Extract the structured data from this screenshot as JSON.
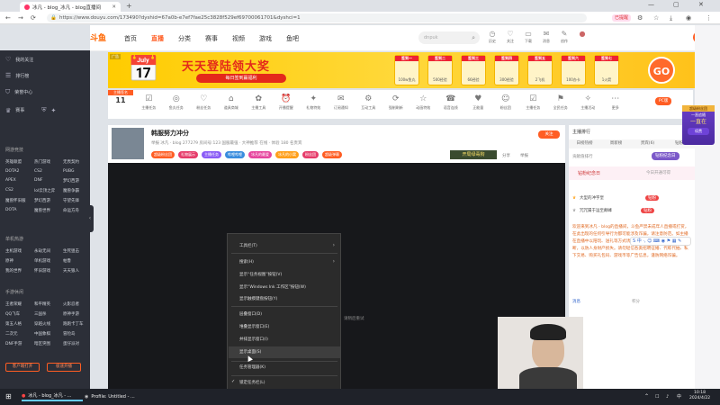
{
  "browser": {
    "tab_title": "冰凡 - blog_冰凡 - blog直播间",
    "url": "https://www.douyu.com/173490?dyshid=67a0b-e7ef7fae25c3828f529ef69700061701&dyshci=1",
    "ext_label": "已提醒",
    "ext2_label": "冰冰"
  },
  "header": {
    "logo": "斗鱼",
    "nav": [
      "首页",
      "直播",
      "分类",
      "赛事",
      "视频",
      "游戏",
      "鱼吧"
    ],
    "search_placeholder": "dnpuk",
    "icons": [
      {
        "icon": "history-icon",
        "label": "历史"
      },
      {
        "icon": "follow-icon",
        "label": "关注"
      },
      {
        "icon": "download-icon",
        "label": "下载"
      },
      {
        "icon": "message-icon",
        "label": "消息"
      },
      {
        "icon": "create-icon",
        "label": "创作"
      }
    ],
    "open_button": "开播"
  },
  "sidebar": {
    "items": [
      {
        "icon": "heart-icon",
        "label": "我的关注"
      },
      {
        "icon": "list-icon",
        "label": "排行榜"
      },
      {
        "icon": "shield-icon",
        "label": "荣誉中心"
      },
      {
        "icon": "trophy-icon",
        "label": "赛事"
      }
    ],
    "groups": [
      {
        "title": "网游竞技",
        "items": [
          "英雄联盟",
          "热门游戏",
          "无畏契约",
          "DOTA2",
          "CS2",
          "PUBG",
          "APEX",
          "DNF",
          "梦幻西游",
          "CS2",
          "lol云顶之弈",
          "魔兽争霸",
          "魔兽怀旧服",
          "梦幻西游",
          "守望先锋",
          "DOTA",
          "魔兽世界",
          "命运方舟"
        ]
      },
      {
        "title": "单机热游",
        "items": [
          "主机游戏",
          "永劫无间",
          "生死狙击",
          "原神",
          "单机游戏",
          "帕鲁",
          "我的世界",
          "怀旧游戏",
          "天天狼人"
        ]
      },
      {
        "title": "手游休闲",
        "items": [
          "王者荣耀",
          "和平精英",
          "火影忍者",
          "QQ飞车",
          "三国杀",
          "原神手游",
          "第五人格",
          "穿越火线",
          "跑跑卡丁车",
          "二次元",
          "中国象棋",
          "冒险岛",
          "DNF手游",
          "暗区突围",
          "蛋仔派对"
        ]
      }
    ],
    "btn_left": "客户端打开",
    "btn_right": "极速开播"
  },
  "banner": {
    "tag": "广告",
    "title": "天天登陆领大奖",
    "subtitle": "每日签到赢福利",
    "prizes": [
      {
        "day": "签到一",
        "label": "100w鱼丸"
      },
      {
        "day": "签到二",
        "label": "500经验"
      },
      {
        "day": "签到三",
        "label": "66经验"
      },
      {
        "day": "签到四",
        "label": "300经验"
      },
      {
        "day": "签到五",
        "label": "2飞机"
      },
      {
        "day": "签到六",
        "label": "100办卡"
      },
      {
        "day": "签到七",
        "label": "1火箭"
      }
    ],
    "go": "GO"
  },
  "iconrow": {
    "level_tag": "主播签名",
    "level": "11",
    "items": [
      "主播任务",
      "鱼丸任务",
      "粉丝任务",
      "道具商城",
      "主播工具",
      "开播提醒",
      "礼物特效",
      "订阅通知",
      "互动工具",
      "强制刷新",
      "动画特效",
      "语音连线",
      "正能量",
      "粉丝团",
      "主播任务",
      "全民任务",
      "主播活动",
      "更多"
    ],
    "pc_badge": "PC版"
  },
  "room": {
    "title": "韩服努力冲分",
    "meta": "举报  冰凡 · blog  277279  房间号:123  国服最强 · 大神推荐  在线 · 体验  180 名贵宾",
    "tags": [
      "超级粉丝团",
      "礼物展示",
      "主播任务",
      "哔哩哔哩",
      "冰凡的最爱",
      "冰凡的小窝",
      "粉丝团",
      "超级弹幕"
    ],
    "banner_btn": "开局绿毒狗",
    "share": "分享",
    "report": "举报",
    "follow": "关注"
  },
  "context_menu": {
    "items": [
      {
        "label": "工具栏(T)",
        "arrow": true
      },
      {
        "label": "搜索(H)",
        "arrow": true
      },
      {
        "label": "显示“任务视图”按钮(V)"
      },
      {
        "label": "显示“Windows Ink 工作区”按钮(W)"
      },
      {
        "label": "显示触摸键盘按钮(Y)"
      },
      {
        "label": "层叠窗口(D)"
      },
      {
        "label": "堆叠显示窗口(E)"
      },
      {
        "label": "并排显示窗口(I)"
      },
      {
        "label": "显示桌面(S)"
      },
      {
        "label": "任务管理器(K)"
      },
      {
        "label": "锁定任务栏(L)",
        "check": true
      },
      {
        "label": "任务栏设置(T)",
        "gear": true
      }
    ],
    "side_note": "请稍后重试"
  },
  "right": {
    "rank_title": "主播排行",
    "tabs": [
      "日榜热榜",
      "周新榜",
      "贵宾(6)",
      "钻粉"
    ],
    "rank_head": "贡献值排行",
    "diamond_tag": "钻粉纪念日",
    "diamond_note": "今日开通可得",
    "ranks": [
      {
        "name": "大型的冲字皇",
        "badge": "钻粉"
      },
      {
        "name": "冗冗属于运至颠峰",
        "badge": "钻粉"
      }
    ],
    "chat": "欢迎来到冰凡 - blog的直播间，斗鱼严禁未成年人直播或打赏，在此出现的任何引导行为都可能涉及诈骗，请注意防范。如主播在直播中以陪玩、送礼等方式诱导您打赏或私下交易，请谨慎判断，以防人身财产损失。请勿轻信各类招聘征婚、代练代抽、私下交易、购买礼包码、游戏币等广告信息，谨防网络诈骗。",
    "chat_tag": "消息",
    "chat_tag2": "积分",
    "level_card": {
      "title": "超级粉丝团",
      "sub": "一直追随",
      "badge": "一直在",
      "btn": "续费"
    }
  },
  "taskbar": {
    "apps": [
      "冰凡 - blog_冰凡 - ...",
      "Profile: Untitled - ..."
    ],
    "time": "10:18",
    "date": "2024/4/22",
    "lang": "中"
  },
  "colors": {
    "accent": "#ff5d23",
    "sidebar": "#2c2f38",
    "video": "#17181b"
  }
}
